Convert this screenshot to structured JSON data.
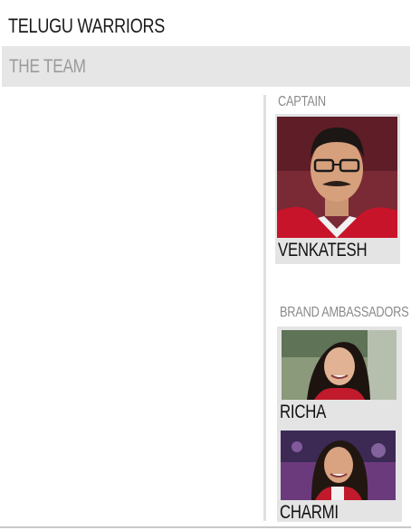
{
  "page": {
    "title": "TELUGU WARRIORS"
  },
  "team_bar": {
    "label": "THE TEAM"
  },
  "captain": {
    "heading": "CAPTAIN",
    "name": "VENKATESH"
  },
  "ambassadors": {
    "heading": "BRAND AMBASSADORS",
    "members": [
      {
        "name": "RICHA"
      },
      {
        "name": "CHARMI"
      }
    ]
  },
  "colors": {
    "bar_bg": "#e6e6e6",
    "card_bg": "#e4e4e4",
    "heading_gray": "#8a8a8a",
    "team_red": "#c0152a"
  }
}
